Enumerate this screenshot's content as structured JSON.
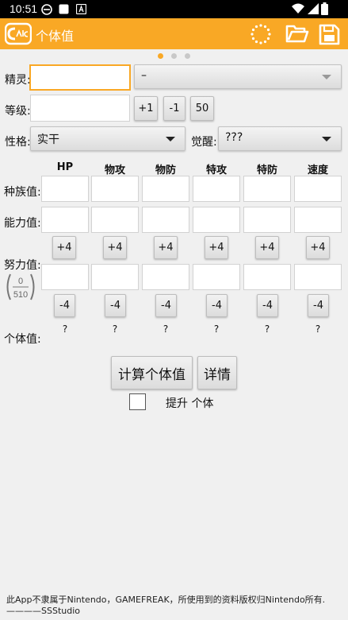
{
  "status_bar": {
    "time": "10:51"
  },
  "app_bar": {
    "title": "个体值"
  },
  "pager": {
    "pages": 3,
    "active": 0
  },
  "form": {
    "pokemon_label": "精灵:",
    "pokemon_value": "",
    "form_select_value": "–",
    "level_label": "等级:",
    "level_value": "",
    "btn_plus1": "+1",
    "btn_minus1": "-1",
    "btn_50": "50",
    "nature_label": "性格:",
    "nature_value": "实干",
    "awaken_label": "觉醒:",
    "awaken_value": "???"
  },
  "stats": {
    "headers": [
      "HP",
      "物攻",
      "物防",
      "特攻",
      "特防",
      "速度"
    ],
    "base_label": "种族值:",
    "stat_label": "能力值:",
    "ev_label": "努力值:",
    "ev_plus": "+4",
    "ev_minus": "-4",
    "ev_total_current": "0",
    "ev_total_max": "510",
    "iv_label": "个体值:",
    "iv_values": [
      "?",
      "?",
      "?",
      "?",
      "?",
      "?"
    ]
  },
  "actions": {
    "calc_button": "计算个体值",
    "detail_button": "详情",
    "checkbox_label": "提升 个体",
    "checkbox_checked": false
  },
  "footer": {
    "line1": "此App不隶属于Nintendo，GAMEFREAK，所使用到的资料版权归Nintendo所有.",
    "line2": "————SSStudio"
  },
  "colors": {
    "accent": "#f9a825",
    "background": "#f0f0f0"
  }
}
